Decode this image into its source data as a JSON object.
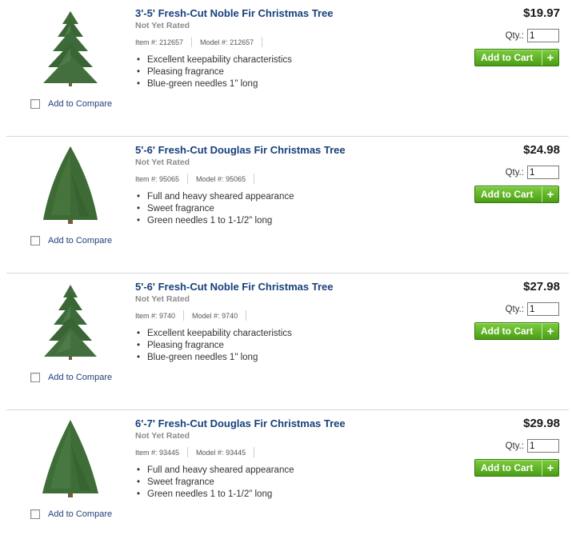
{
  "compare_label": "Add to Compare",
  "qty_label": "Qty.:",
  "cart_label": "Add to Cart",
  "cart_plus": "+",
  "products": [
    {
      "title": "3'-5' Fresh-Cut Noble Fir Christmas Tree",
      "rating": "Not Yet Rated",
      "item": "Item #: 212657",
      "model": "Model #: 212657",
      "features": [
        "Excellent keepability characteristics",
        "Pleasing fragrance",
        "Blue-green needles 1\" long"
      ],
      "price": "$19.97",
      "qty": "1",
      "image": "noble-fir-tree-image"
    },
    {
      "title": "5'-6' Fresh-Cut Douglas Fir Christmas Tree",
      "rating": "Not Yet Rated",
      "item": "Item #: 95065",
      "model": "Model #: 95065",
      "features": [
        "Full and heavy sheared appearance",
        "Sweet fragrance",
        "Green needles 1 to 1-1/2\" long"
      ],
      "price": "$24.98",
      "qty": "1",
      "image": "douglas-fir-tree-image"
    },
    {
      "title": "5'-6' Fresh-Cut Noble Fir Christmas Tree",
      "rating": "Not Yet Rated",
      "item": "Item #: 9740",
      "model": "Model #: 9740",
      "features": [
        "Excellent keepability characteristics",
        "Pleasing fragrance",
        "Blue-green needles 1\" long"
      ],
      "price": "$27.98",
      "qty": "1",
      "image": "noble-fir-tree-image"
    },
    {
      "title": "6'-7' Fresh-Cut Douglas Fir Christmas Tree",
      "rating": "Not Yet Rated",
      "item": "Item #: 93445",
      "model": "Model #: 93445",
      "features": [
        "Full and heavy sheared appearance",
        "Sweet fragrance",
        "Green needles 1 to 1-1/2\" long"
      ],
      "price": "$29.98",
      "qty": "1",
      "image": "douglas-fir-tree-image"
    }
  ]
}
